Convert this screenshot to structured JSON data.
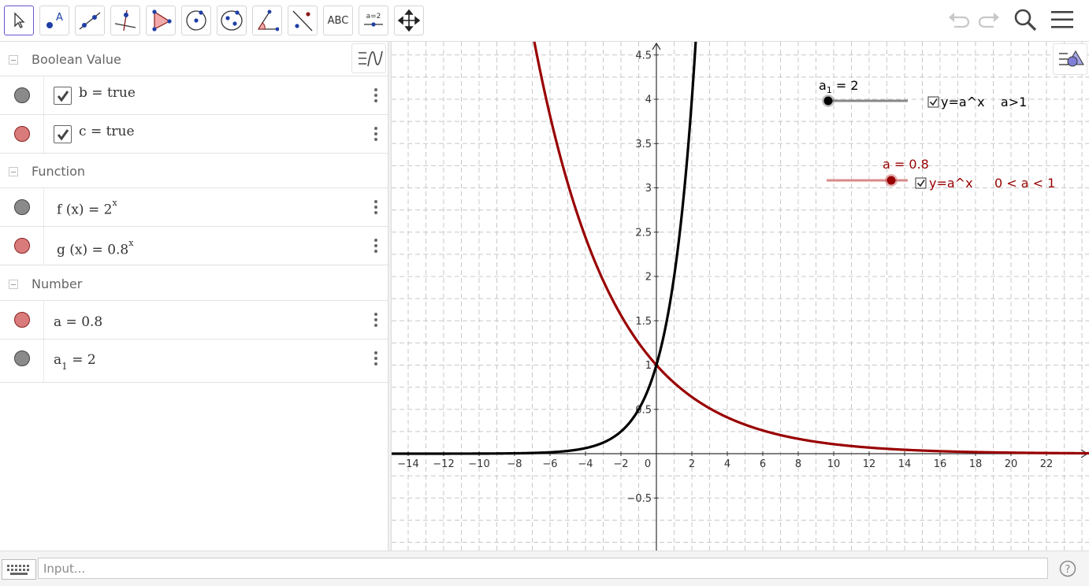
{
  "toolbar": {
    "tools": [
      {
        "id": "move",
        "icon": "arrow-cursor-icon"
      },
      {
        "id": "point",
        "icon": "point-icon",
        "label": "A"
      },
      {
        "id": "line",
        "icon": "line-icon"
      },
      {
        "id": "perpendicular",
        "icon": "perpendicular-line-icon"
      },
      {
        "id": "polygon",
        "icon": "polygon-icon"
      },
      {
        "id": "circle",
        "icon": "circle-center-point-icon"
      },
      {
        "id": "conic",
        "icon": "ellipse-icon"
      },
      {
        "id": "angle",
        "icon": "angle-icon"
      },
      {
        "id": "reflect",
        "icon": "reflect-line-icon"
      },
      {
        "id": "text",
        "icon": "text-icon",
        "label": "ABC"
      },
      {
        "id": "slider",
        "icon": "slider-icon",
        "label": "a=2"
      },
      {
        "id": "move-graphics",
        "icon": "move-graphics-icon"
      }
    ],
    "right": [
      {
        "id": "undo",
        "icon": "undo-icon"
      },
      {
        "id": "redo",
        "icon": "redo-icon"
      },
      {
        "id": "search",
        "icon": "search-icon"
      },
      {
        "id": "menu",
        "icon": "hamburger-menu-icon"
      }
    ]
  },
  "algebra": {
    "groups": [
      {
        "title": "Boolean Value"
      },
      {
        "title": "Function"
      },
      {
        "title": "Number"
      }
    ],
    "rows": {
      "b": {
        "name": "b",
        "eq": "=",
        "value": "true",
        "color": "gray",
        "checked": true
      },
      "c": {
        "name": "c",
        "eq": "=",
        "value": "true",
        "color": "red",
        "checked": true
      },
      "f": {
        "lhs": "f (x)",
        "eq": "=",
        "base": "2",
        "exp": "x",
        "color": "gray"
      },
      "g": {
        "lhs": "g (x)",
        "eq": "=",
        "base": "0.8",
        "exp": "x",
        "color": "red"
      },
      "a": {
        "name": "a",
        "eq": "=",
        "value": "0.8",
        "color": "red"
      },
      "a1": {
        "name": "a",
        "sub": "1",
        "eq": "=",
        "value": "2",
        "color": "gray"
      }
    }
  },
  "graphics": {
    "x_ticks": [
      "−14",
      "−12",
      "−10",
      "−8",
      "−6",
      "−4",
      "−2",
      "0",
      "2",
      "4",
      "6",
      "8",
      "10",
      "12",
      "14",
      "16",
      "18",
      "20",
      "22"
    ],
    "y_ticks": [
      "−0.5",
      "0.5",
      "1",
      "1.5",
      "2",
      "2.5",
      "3",
      "3.5",
      "4",
      "4.5"
    ],
    "slider_a1": {
      "name": "a",
      "sub": "1",
      "eq": " = 2",
      "value": 2,
      "color": "#000000"
    },
    "slider_a": {
      "label": "a = 0.8",
      "value": 0.8,
      "color": "#990000"
    },
    "checkbox_b": {
      "label": "y=a^x    a>1",
      "checked": true
    },
    "checkbox_c": {
      "label": "y=a^x",
      "cond": "0 < a < 1",
      "checked": true
    },
    "curve_f": {
      "expr": "2^x",
      "color": "#000000"
    },
    "curve_g": {
      "expr": "0.8^x",
      "color": "#990000"
    }
  },
  "input": {
    "placeholder": "Input..."
  }
}
